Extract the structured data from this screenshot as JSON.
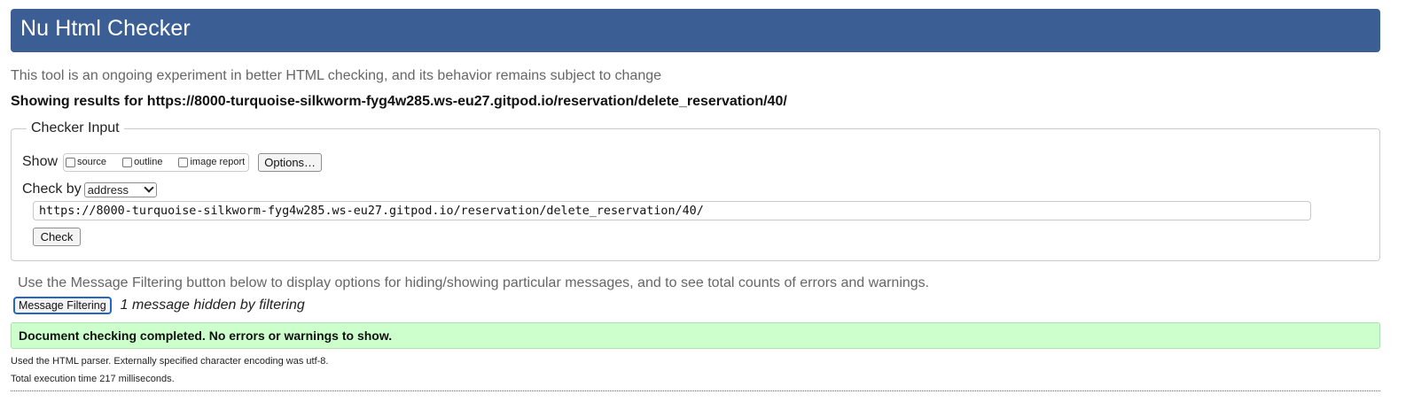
{
  "header": {
    "title": "Nu Html Checker"
  },
  "intro": "This tool is an ongoing experiment in better HTML checking, and its behavior remains subject to change",
  "showing_results": "Showing results for https://8000-turquoise-silkworm-fyg4w285.ws-eu27.gitpod.io/reservation/delete_reservation/40/",
  "checker_input": {
    "legend": "Checker Input",
    "show_label": "Show",
    "show_options": [
      {
        "label": "source",
        "checked": false
      },
      {
        "label": "outline",
        "checked": false
      },
      {
        "label": "image report",
        "checked": false
      }
    ],
    "options_button": "Options…",
    "check_by_label": "Check by",
    "check_by_selected": "address",
    "url_value": "https://8000-turquoise-silkworm-fyg4w285.ws-eu27.gitpod.io/reservation/delete_reservation/40/",
    "check_button": "Check"
  },
  "filtering": {
    "note": "Use the Message Filtering button below to display options for hiding/showing particular messages, and to see total counts of errors and warnings.",
    "button": "Message Filtering",
    "hidden_count_text": "1 message hidden by filtering"
  },
  "result": {
    "message": "Document checking completed. No errors or warnings to show."
  },
  "details": {
    "parser": "Used the HTML parser. Externally specified character encoding was utf-8.",
    "exec_time": "Total execution time 217 milliseconds."
  },
  "colors": {
    "header_bg": "#3b5f95",
    "success_bg": "#ccffcc",
    "focus_ring": "#2566c4"
  }
}
